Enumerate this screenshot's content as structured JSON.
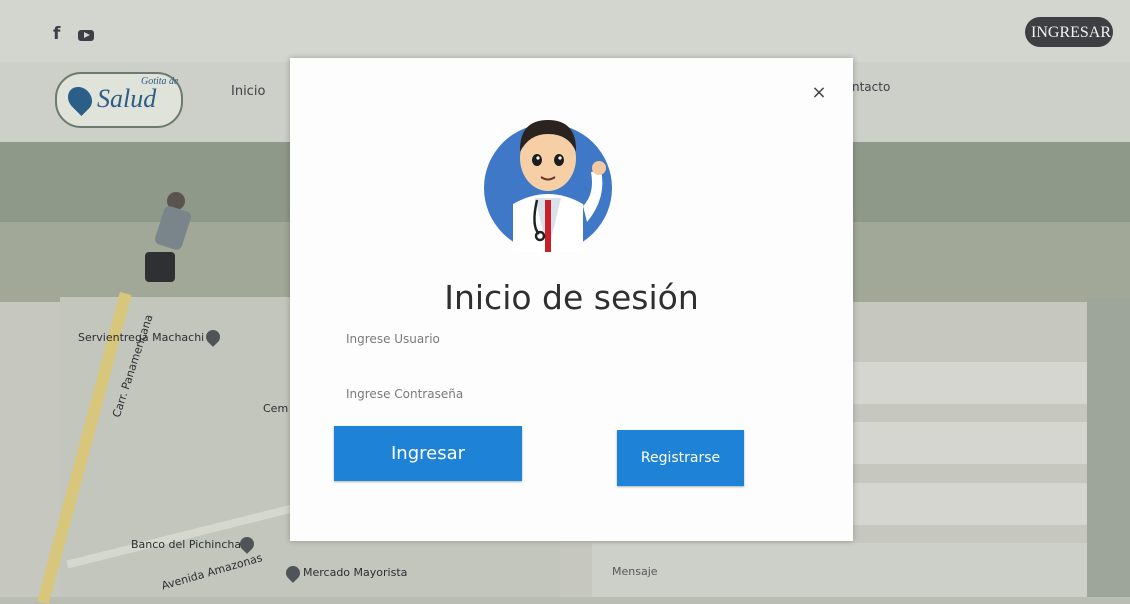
{
  "header": {
    "login_button": "INGRESAR",
    "facebook_icon": "f",
    "youtube_icon": "youtube-icon"
  },
  "navbar": {
    "logo_small": "Gotita de",
    "logo_text": "Salud",
    "link_left": "Inicio",
    "link_right": "ntacto"
  },
  "map": {
    "labels": {
      "servientrega": "Servientrega Machachi",
      "carr": "Carr. Panamericana",
      "cem": "Cem",
      "banco": "Banco del Pichincha",
      "mercado": "Mercado Mayorista",
      "avenida": "Avenida Amazonas"
    }
  },
  "contact_form": {
    "message_label": "Mensaje"
  },
  "modal": {
    "title": "Inicio de sesión",
    "username_placeholder": "Ingrese Usuario",
    "password_placeholder": "Ingrese Contraseña",
    "login_button": "Ingresar",
    "register_button": "Registrarse",
    "close": "×",
    "avatar_icon": "doctor-avatar-icon"
  },
  "colors": {
    "accent": "#1e82d6",
    "avatar_bg": "#3f78c6"
  }
}
